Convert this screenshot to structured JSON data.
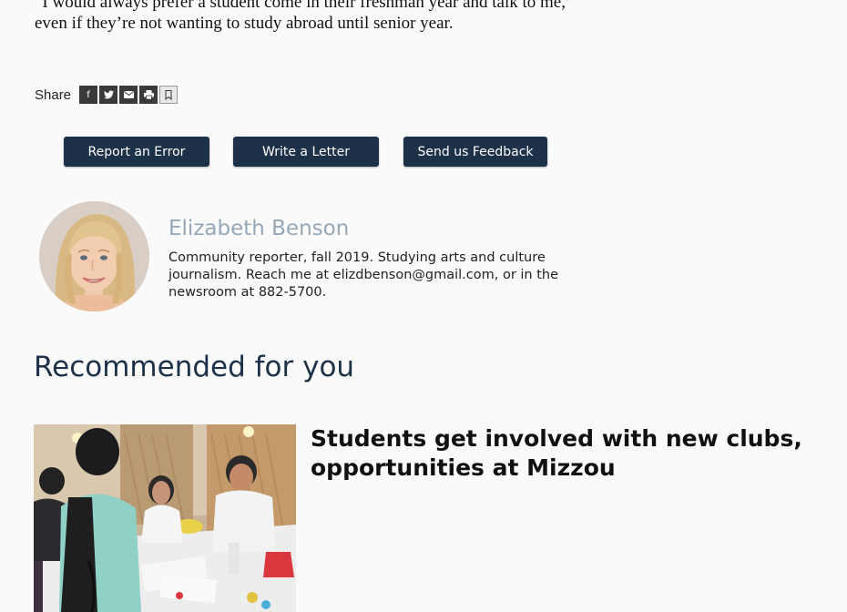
{
  "article": {
    "quote_text": "“I would always prefer a student come in their freshman year and talk to me,” even if they’re not wanting to study abroad until senior year."
  },
  "share": {
    "label": "Share",
    "buttons": [
      {
        "icon": "facebook-icon",
        "glyph": "f"
      },
      {
        "icon": "twitter-icon",
        "glyph": "🐦"
      },
      {
        "icon": "email-icon",
        "glyph": "✉"
      },
      {
        "icon": "print-icon",
        "glyph": "⎙"
      },
      {
        "icon": "bookmark-icon",
        "glyph": "🔖"
      }
    ]
  },
  "actions": {
    "report_error": "Report an Error",
    "write_letter": "Write a Letter",
    "feedback": "Send us Feedback"
  },
  "author": {
    "name": "Elizabeth Benson",
    "bio": "Community reporter, fall 2019. Studying arts and culture journalism. Reach me at elizdbenson@gmail.com, or in the newsroom at 882-5700."
  },
  "recommended": {
    "heading": "Recommended for you",
    "items": [
      {
        "title": "Students get involved with new clubs, opportunities at Mizzou"
      }
    ]
  },
  "colors": {
    "button_bg": "#1d3148",
    "heading": "#1d3148",
    "author_name": "#96a8b8",
    "share_icon_bg": "#3a3a3a"
  }
}
